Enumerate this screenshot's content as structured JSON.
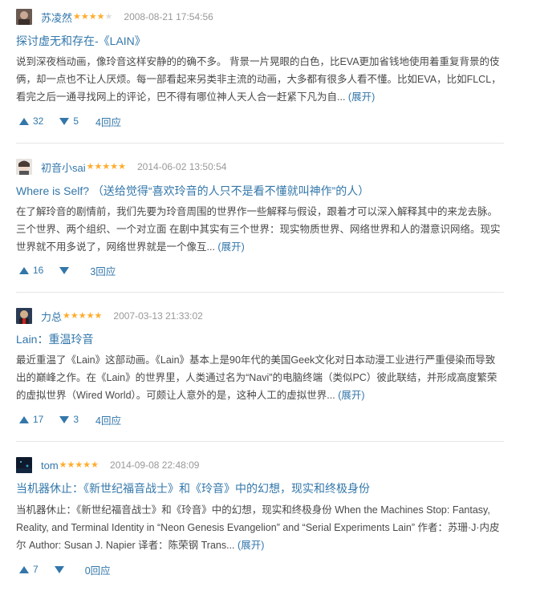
{
  "reviews": [
    {
      "author": "苏凌然",
      "rating": 4,
      "time": "2008-08-21 17:54:56",
      "title": "探讨虚无和存在-《LAIN》",
      "body": "说到深夜档动画，像玲音这样安静的的确不多。 背景一片晃眼的白色，比EVA更加省钱地使用着重复背景的伎俩，却一点也不让人厌烦。每一部看起来另类非主流的动画，大多都有很多人看不懂。比如EVA，比如FLCL，看完之后一通寻找网上的评论，巴不得有哪位神人天人合一赶紧下凡为自...",
      "expand": "(展开)",
      "up": "32",
      "down": "5",
      "replies": "4回应"
    },
    {
      "author": "初音小sai",
      "rating": 5,
      "time": "2014-06-02 13:50:54",
      "title": "Where is Self? （送给觉得“喜欢玲音的人只不是看不懂就叫神作”的人）",
      "body": "在了解玲音的剧情前，我们先要为玲音周围的世界作一些解释与假设，跟着才可以深入解释其中的来龙去脉。 三个世界、两个组织、一个对立面 在剧中其实有三个世界：现实物质世界、网络世界和人的潜意识网络。现实世界就不用多说了，网络世界就是一个像互...",
      "expand": "(展开)",
      "up": "16",
      "down": "",
      "replies": "3回应"
    },
    {
      "author": "力总",
      "rating": 5,
      "time": "2007-03-13 21:33:02",
      "title": "Lain：重温玲音",
      "body": "最近重温了《Lain》这部动画。《Lain》基本上是90年代的美国Geek文化对日本动漫工业进行严重侵染而导致出的巅峰之作。在《Lain》的世界里，人类通过名为“Navi”的电脑终端（类似PC）彼此联结，并形成高度繁荣的虚拟世界（Wired World）。可颇让人意外的是，这种人工的虚拟世界...",
      "expand": "(展开)",
      "up": "17",
      "down": "3",
      "replies": "4回应"
    },
    {
      "author": "tom",
      "rating": 5,
      "time": "2014-09-08 22:48:09",
      "title": "当机器休止：《新世纪福音战士》和《玲音》中的幻想，现实和终极身份",
      "body": "当机器休止：《新世纪福音战士》和《玲音》中的幻想，现实和终极身份 When the Machines Stop: Fantasy, Reality, and Terminal Identity in “Neon Genesis Evangelion” and “Serial Experiments Lain” 作者：苏珊·J·内皮尔 Author: Susan J. Napier 译者：陈荣钢 Trans...",
      "expand": "(展开)",
      "up": "7",
      "down": "",
      "replies": "0回应"
    }
  ]
}
